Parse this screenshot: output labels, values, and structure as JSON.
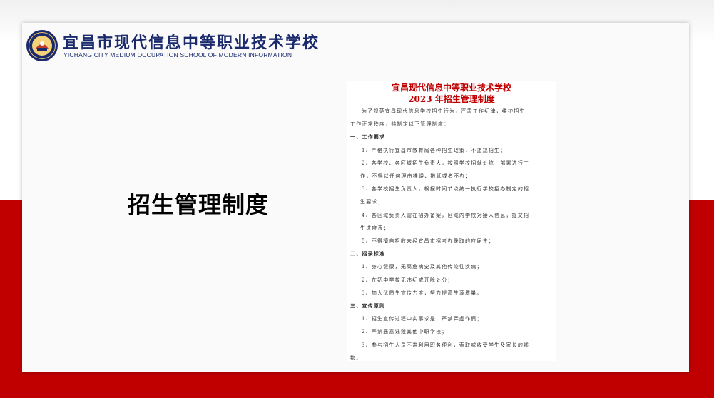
{
  "school": {
    "name_cn": "宜昌市现代信息中等职业技术学校",
    "name_en": "YICHANG CITY MEDIUM OCCUPATION SCHOOL OF MODERN INFORMATION"
  },
  "slide_title": "招生管理制度",
  "document": {
    "title_line1": "宜昌现代信息中等职业技术学校",
    "title_line2": "2023 年招生管理制度",
    "lines": [
      {
        "text": "为了规范宜昌现代信息学校招生行为，严肃工作纪律，维护招生",
        "kind": "ind1"
      },
      {
        "text": "工作正常秩序，特制定以下管理制度：",
        "kind": "ind0"
      },
      {
        "text": "一、工作要求",
        "kind": "sec"
      },
      {
        "text": "1、严格执行宜昌市教育局各种招生政策，不违规招生；",
        "kind": "ind2"
      },
      {
        "text": "2、各学校、各区域招生负责人，按照学校招就处统一部署进行工",
        "kind": "ind2"
      },
      {
        "text": "作，不得以任何理由推诿、拖延或者不办；",
        "kind": "cont"
      },
      {
        "text": "3、各学校招生负责人，根据时间节点统一执行学校招办制定的招",
        "kind": "ind2"
      },
      {
        "text": "生要求；",
        "kind": "cont"
      },
      {
        "text": "4、各区域负责人需在招办备案，区域内学校对接人信息，提交招",
        "kind": "ind2"
      },
      {
        "text": "生进度表；",
        "kind": "cont"
      },
      {
        "text": "5、不得擅自招收未经宜昌市招考办录取的应届生；",
        "kind": "ind2"
      },
      {
        "text": "二、招录标准",
        "kind": "sec"
      },
      {
        "text": "1、身心健康，无高危病史及其他传染性疾病；",
        "kind": "ind2"
      },
      {
        "text": "2、在初中学校无违纪或开除处分；",
        "kind": "ind2"
      },
      {
        "text": "3、加大优质生宣传力度，努力提高生源质量。",
        "kind": "ind2"
      },
      {
        "text": "三、宣传原则",
        "kind": "sec"
      },
      {
        "text": "1、招生宣传过程中实事求是，严禁弄虚作假；",
        "kind": "ind2"
      },
      {
        "text": "2、严禁恶意诋毁其他中职学校；",
        "kind": "ind2"
      },
      {
        "text": "3、参与招生人员不准利用职务便利，索取或收受学生及家长的钱",
        "kind": "ind2"
      },
      {
        "text": "物。",
        "kind": "ind0"
      }
    ]
  },
  "colors": {
    "accent_red": "#c00000",
    "school_blue": "#1a2a6c"
  }
}
